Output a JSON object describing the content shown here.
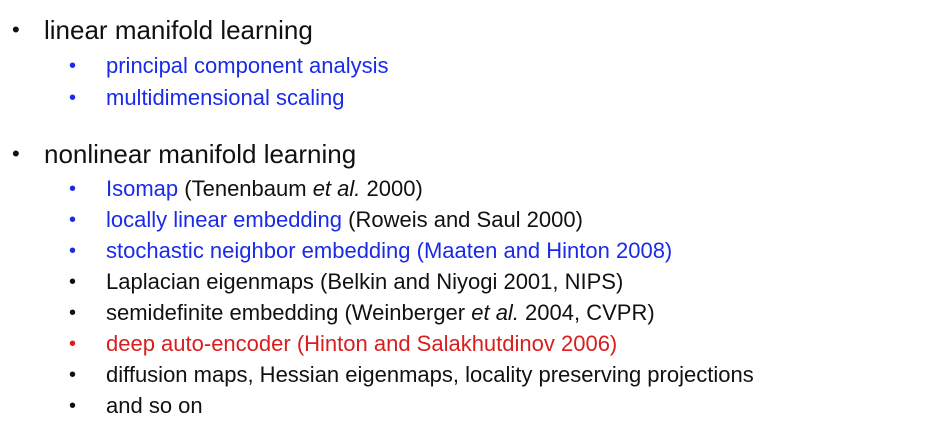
{
  "colors": {
    "blue": "#1a2be8",
    "red": "#d81e1e",
    "black": "#111111"
  },
  "bullet": "•",
  "sections": [
    {
      "title": "linear manifold learning",
      "items": [
        {
          "label": "principal component analysis"
        },
        {
          "label": "multidimensional scaling"
        }
      ]
    },
    {
      "title": "nonlinear manifold learning",
      "items": [
        {
          "label": "Isomap",
          "ref_pre": " (Tenenbaum ",
          "ref_em": "et al.",
          "ref_post": " 2000)"
        },
        {
          "label": "locally linear embedding",
          "ref": " (Roweis and Saul 2000)"
        },
        {
          "label": "stochastic neighbor embedding (Maaten and Hinton 2008)"
        },
        {
          "label": "Laplacian eigenmaps (Belkin and Niyogi 2001, NIPS)"
        },
        {
          "label_pre": "semidefinite embedding (Weinberger ",
          "label_em": "et al.",
          "label_post": " 2004, CVPR)"
        },
        {
          "label": "deep auto-encoder (Hinton and Salakhutdinov 2006)"
        },
        {
          "label": "diffusion maps, Hessian eigenmaps, locality preserving projections"
        },
        {
          "label": "and so on"
        }
      ]
    }
  ]
}
